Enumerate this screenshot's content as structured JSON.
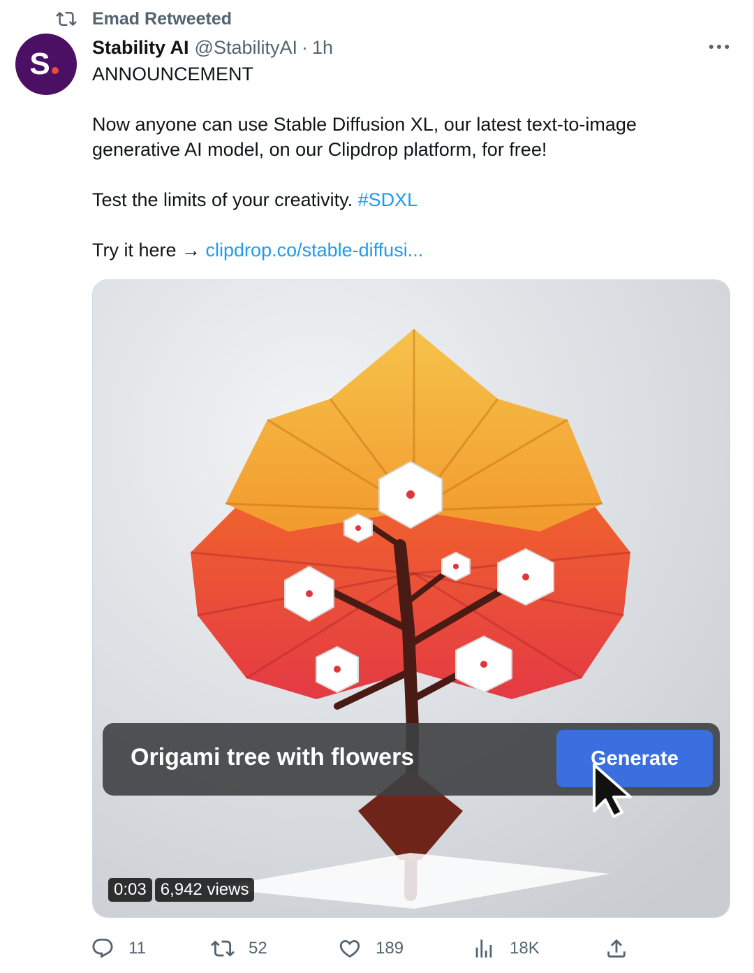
{
  "social_context": {
    "text": "Emad Retweeted"
  },
  "author": {
    "name": "Stability AI",
    "handle": "@StabilityAI",
    "separator": "·",
    "time": "1h",
    "avatar_letter": "S"
  },
  "tweet": {
    "line1": "ANNOUNCEMENT",
    "line2": "Now anyone can use Stable Diffusion XL, our latest text-to-image generative AI model, on our Clipdrop platform, for free!",
    "line3_text": "Test the limits of your creativity. ",
    "line3_hashtag": "#SDXL",
    "line4_text": "Try it here → ",
    "line4_link": "clipdrop.co/stable-diffusi..."
  },
  "media": {
    "prompt_text": "Origami tree with flowers",
    "generate_label": "Generate",
    "duration": "0:03",
    "views": "6,942 views"
  },
  "actions": {
    "reply_count": "11",
    "retweet_count": "52",
    "like_count": "189",
    "views_count": "18K"
  },
  "colors": {
    "link": "#1d9bf0",
    "muted": "#536471",
    "avatar_bg": "#4b0f64",
    "button_blue": "#3b6fe0"
  },
  "icons": [
    "retweet-icon",
    "more-icon",
    "reply-icon",
    "like-icon",
    "analytics-icon",
    "share-icon",
    "cursor-icon"
  ]
}
